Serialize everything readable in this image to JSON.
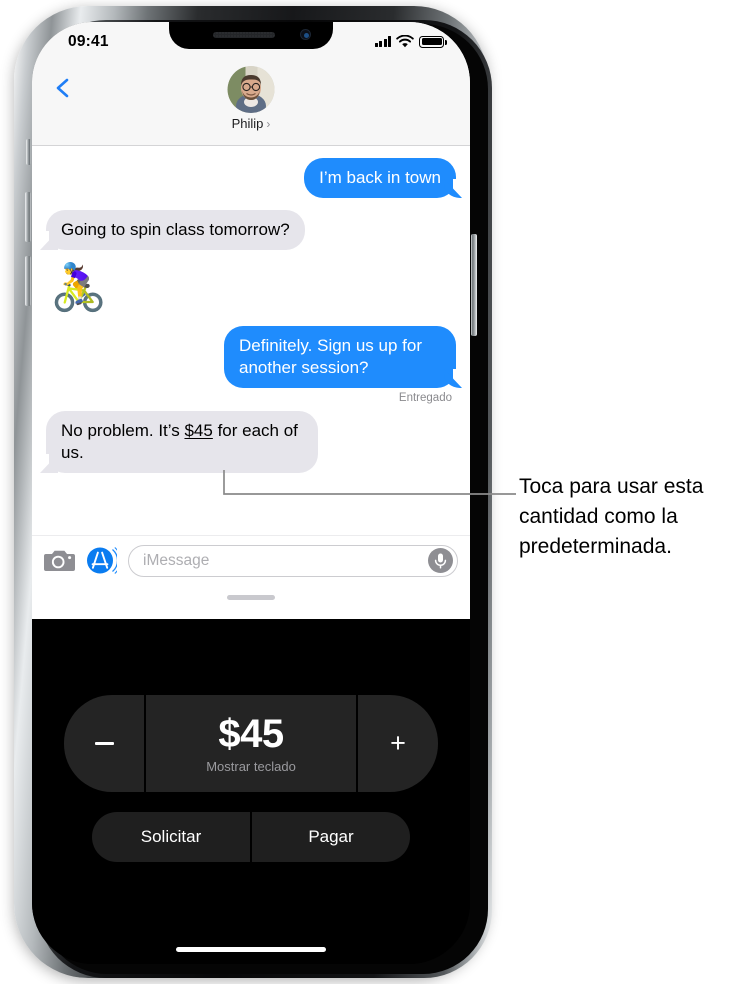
{
  "device": {
    "status_bar": {
      "time": "09:41",
      "signal_icon": "cellular-signal-icon",
      "wifi_icon": "wifi-icon",
      "battery_icon": "battery-full-icon"
    },
    "home_indicator": "home-indicator"
  },
  "messages_app": {
    "back_icon": "back-chevron-icon",
    "contact": {
      "name": "Philip",
      "disclosure_arrow": "›",
      "avatar_alt": "contact-avatar"
    },
    "thread": [
      {
        "id": "m1",
        "side": "out",
        "text": "I’m back in town"
      },
      {
        "id": "m2",
        "side": "in",
        "text": "Going to spin class tomorrow?"
      },
      {
        "id": "m3",
        "side": "in",
        "type": "emoji",
        "text": "🚴‍♀️"
      },
      {
        "id": "m4",
        "side": "out",
        "text": "Definitely. Sign us up for another session?"
      },
      {
        "id": "m5",
        "side": "in",
        "type": "detected",
        "text_before": "No problem. It’s ",
        "detected": "$45",
        "text_after": " for each of us."
      }
    ],
    "delivered_label": "Entregado",
    "input_bar": {
      "camera_icon": "camera-icon",
      "appstore_icon": "app-store-icon",
      "placeholder": "iMessage",
      "mic_icon": "microphone-icon"
    },
    "grabber": "drag-handle"
  },
  "apple_pay_panel": {
    "decrease_label": "−",
    "increase_label": "+",
    "amount": "$45",
    "keyboard_label": "Mostrar teclado",
    "request_label": "Solicitar",
    "pay_label": "Pagar"
  },
  "annotation": {
    "text": "Toca para usar esta cantidad como la predeterminada."
  },
  "colors": {
    "bubble_out": "#1f8cfd",
    "bubble_in": "#e6e5eb",
    "accent_blue": "#007aff",
    "panel_black": "#000000",
    "control_gray": "#242424"
  }
}
